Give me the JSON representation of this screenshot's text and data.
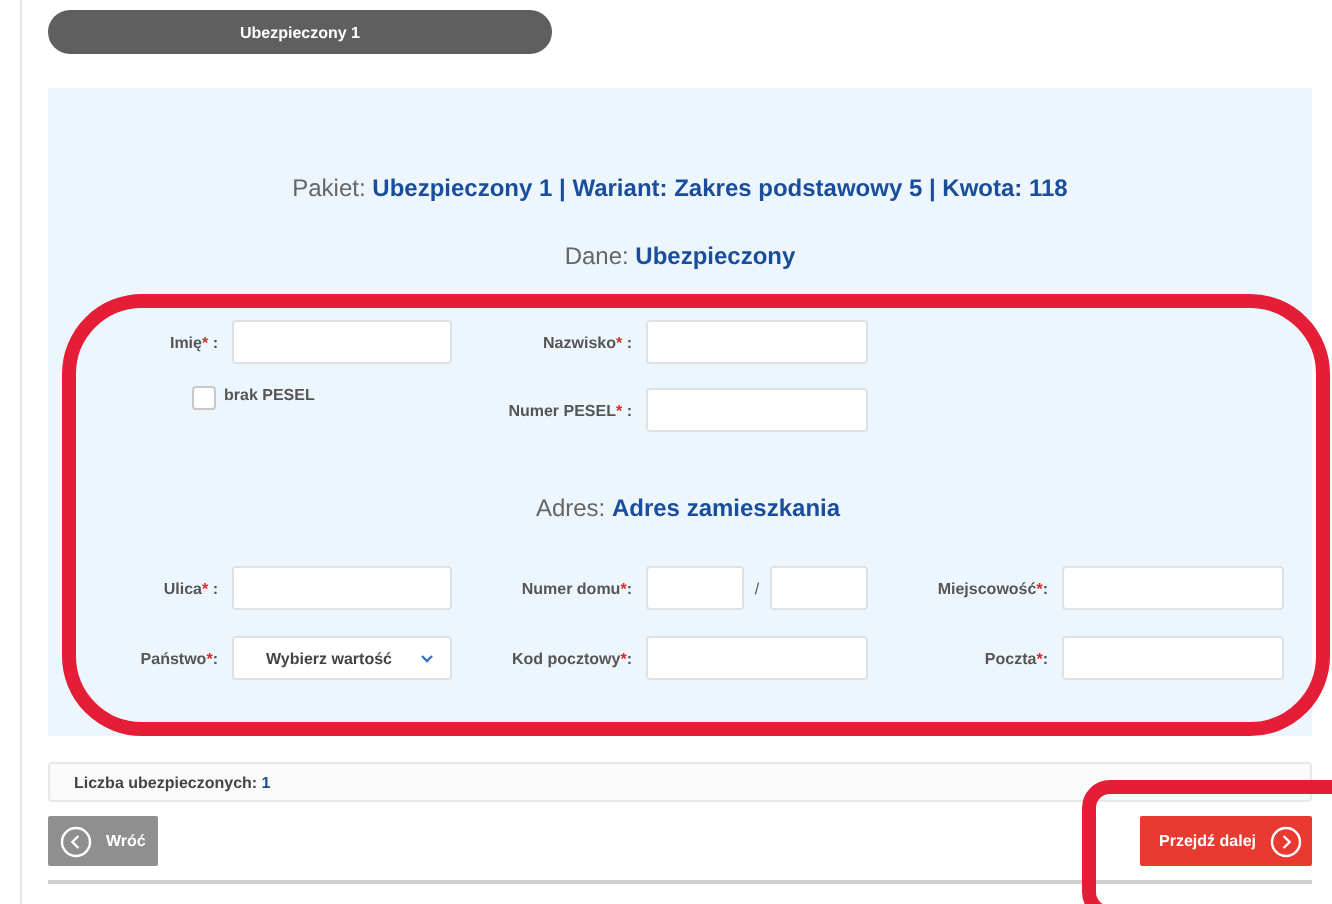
{
  "tab": {
    "label": "Ubezpieczony 1"
  },
  "summary": {
    "prefix": "Pakiet:",
    "value": "Ubezpieczony 1 | Wariant: Zakres podstawowy 5 | Kwota: 118"
  },
  "data_heading": {
    "prefix": "Dane:",
    "value": "Ubezpieczony"
  },
  "person_rows": [
    [
      {
        "kind": "text",
        "label": "Imię",
        "asterisk": "*",
        "suffix": " :"
      },
      {
        "kind": "text",
        "label": "Nazwisko",
        "asterisk": "*",
        "suffix": " :"
      }
    ],
    [
      {
        "kind": "checkbox",
        "label": "brak PESEL",
        "checked": false
      },
      {
        "kind": "text",
        "label": "Numer PESEL",
        "asterisk": "*",
        "suffix": " :"
      }
    ]
  ],
  "address_heading": {
    "prefix": "Adres:",
    "value": "Adres zamieszkania"
  },
  "address_rows": [
    [
      {
        "kind": "text",
        "label": "Ulica",
        "asterisk": "*",
        "suffix": " :"
      },
      {
        "kind": "house_number",
        "label": "Numer domu",
        "asterisk": "*",
        "suffix": ":",
        "separator": "/"
      },
      {
        "kind": "text",
        "label": "Miejscowość",
        "asterisk": "*",
        "suffix": ":"
      }
    ],
    [
      {
        "kind": "select",
        "label": "Państwo",
        "asterisk": "*",
        "suffix": ":",
        "placeholder": "Wybierz wartość"
      },
      {
        "kind": "text",
        "label": "Kod pocztowy",
        "asterisk": "*",
        "suffix": ":"
      },
      {
        "kind": "text",
        "label": "Poczta",
        "asterisk": "*",
        "suffix": ":"
      }
    ]
  ],
  "count": {
    "label": "Liczba ubezpieczonych:",
    "value": "1"
  },
  "back_button": {
    "label": "Wróć"
  },
  "next_button": {
    "label": "Przejdź dalej"
  },
  "highlights": {
    "form": true,
    "next_button": true
  }
}
